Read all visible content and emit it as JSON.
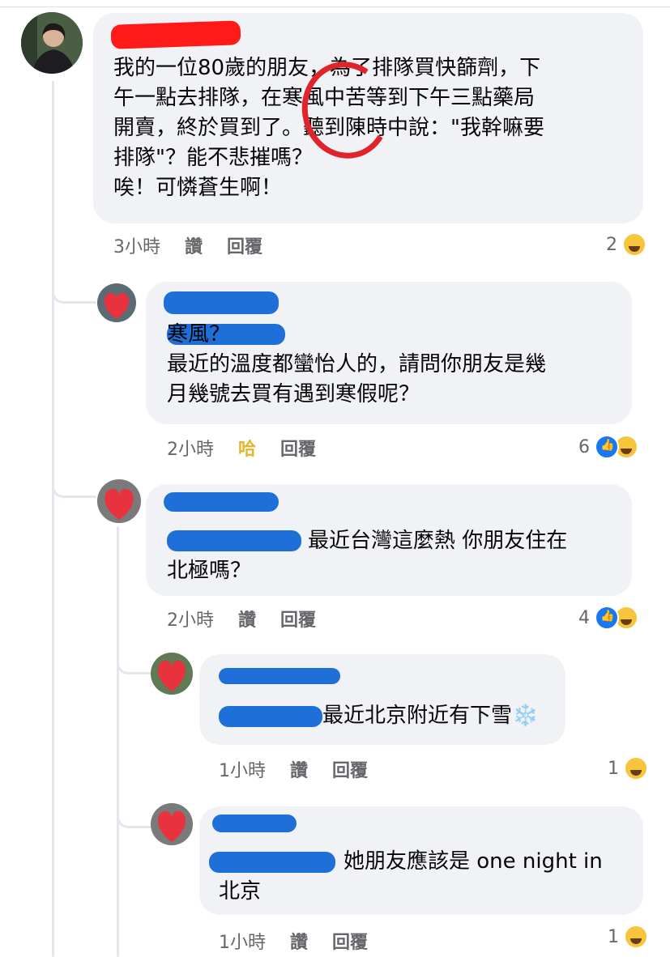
{
  "colors": {
    "bubble": "#f0f2f5",
    "redaction_red": "#ff1a1a",
    "redaction_blue": "#1f6fd8",
    "annotation_red": "#e0242c",
    "haha_active": "#e5b52b"
  },
  "comments": [
    {
      "text": "我的一位80歲的朋友，為了排隊買快篩劑，下\n午一點去排隊，在寒風中苦等到下午三點藥局\n開賣，終於買到了。聽到陳時中說：\"我幹嘛要\n排隊\"？能不悲摧嗎？\n唉！可憐蒼生啊！",
      "time": "3小時",
      "like_label": "讚",
      "reply_label": "回覆",
      "reaction_count": "2",
      "reactions": [
        "haha-icon"
      ]
    },
    {
      "text": "寒風？\n最近的溫度都蠻怡人的，請問你朋友是幾\n月幾號去買有遇到寒假呢？",
      "time": "2小時",
      "like_label": "哈",
      "reply_label": "回覆",
      "reaction_count": "6",
      "reactions": [
        "like-icon",
        "haha-icon"
      ]
    },
    {
      "text": "最近台灣這麼熱 你朋友住在\n北極嗎？",
      "time": "2小時",
      "like_label": "讚",
      "reply_label": "回覆",
      "reaction_count": "4",
      "reactions": [
        "like-icon",
        "haha-icon"
      ]
    },
    {
      "text": "最近北京附近有下雪❄️",
      "time": "1小時",
      "like_label": "讚",
      "reply_label": "回覆",
      "reaction_count": "1",
      "reactions": [
        "haha-icon"
      ]
    },
    {
      "text": "她朋友應該是 one night in\n北京",
      "time": "1小時",
      "like_label": "讚",
      "reply_label": "回覆",
      "reaction_count": "1",
      "reactions": [
        "haha-icon"
      ]
    }
  ]
}
